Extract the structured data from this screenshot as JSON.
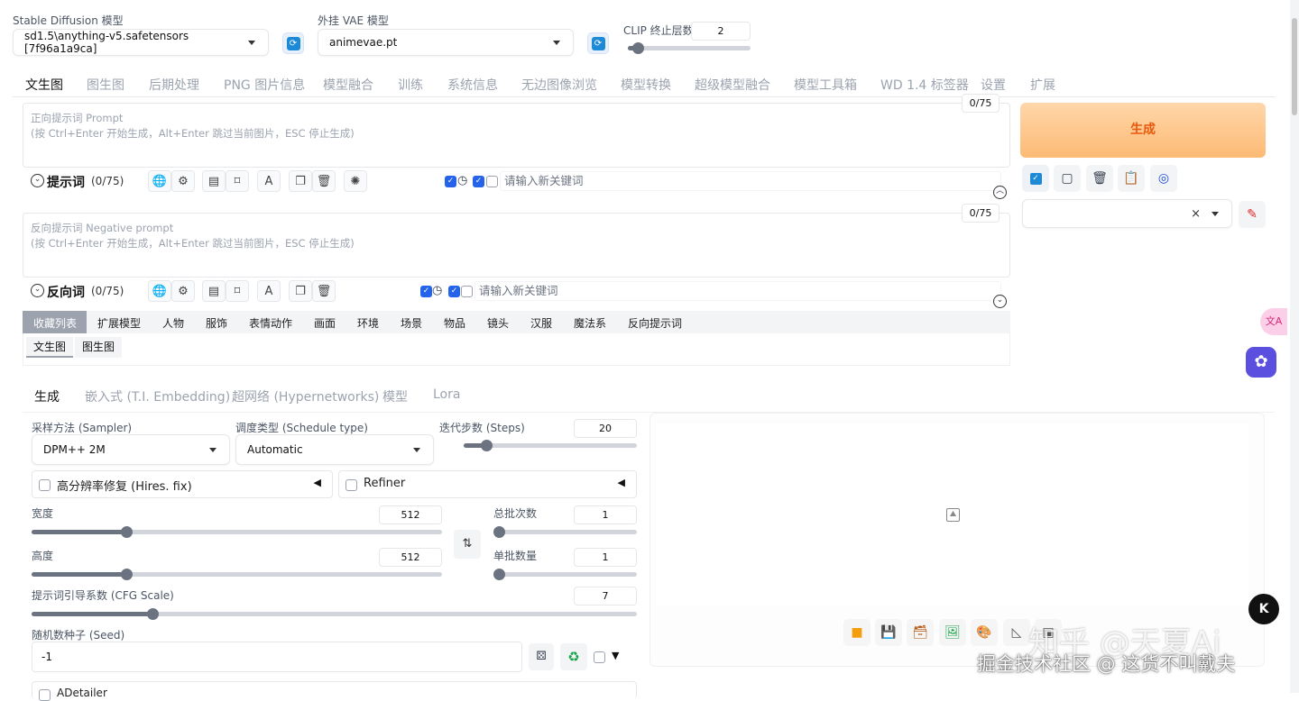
{
  "top": {
    "sd_model_label": "Stable Diffusion 模型",
    "sd_model_value": "sd1.5\\anything-v5.safetensors [7f96a1a9ca]",
    "vae_label": "外挂 VAE 模型",
    "vae_value": "animevae.pt",
    "clip_label": "CLIP 终止层数",
    "clip_value": "2"
  },
  "tabs": [
    "文生图",
    "图生图",
    "后期处理",
    "PNG 图片信息",
    "模型融合",
    "训练",
    "系统信息",
    "无边图像浏览",
    "模型转换",
    "超级模型融合",
    "模型工具箱",
    "WD 1.4 标签器",
    "设置",
    "扩展"
  ],
  "prompt": {
    "counter": "0/75",
    "placeholder_line1": "正向提示词 Prompt",
    "placeholder_line2": "(按 Ctrl+Enter 开始生成，Alt+Enter 跳过当前图片，ESC 停止生成)",
    "title": "提示词",
    "count": "(0/75)",
    "keyword_placeholder": "请输入新关键词"
  },
  "negative": {
    "counter": "0/75",
    "placeholder_line1": "反向提示词 Negative prompt",
    "placeholder_line2": "(按 Ctrl+Enter 开始生成，Alt+Enter 跳过当前图片，ESC 停止生成)",
    "title": "反向词",
    "count": "(0/75)",
    "keyword_placeholder": "请输入新关键词"
  },
  "generate_label": "生成",
  "categories": [
    "收藏列表",
    "扩展模型",
    "人物",
    "服饰",
    "表情动作",
    "画面",
    "环境",
    "场景",
    "物品",
    "镜头",
    "汉服",
    "魔法系",
    "反向提示词"
  ],
  "subcats": [
    "文生图",
    "图生图"
  ],
  "settings_tabs": [
    "生成",
    "嵌入式 (T.I. Embedding)",
    "超网络 (Hypernetworks)",
    "模型",
    "Lora"
  ],
  "settings": {
    "sampler_label": "采样方法 (Sampler)",
    "sampler_value": "DPM++ 2M",
    "schedule_label": "调度类型 (Schedule type)",
    "schedule_value": "Automatic",
    "steps_label": "迭代步数 (Steps)",
    "steps_value": "20",
    "hires_label": "高分辨率修复 (Hires. fix)",
    "refiner_label": "Refiner",
    "width_label": "宽度",
    "width_value": "512",
    "height_label": "高度",
    "height_value": "512",
    "batch_count_label": "总批次数",
    "batch_count_value": "1",
    "batch_size_label": "单批数量",
    "batch_size_value": "1",
    "cfg_label": "提示词引导系数 (CFG Scale)",
    "cfg_value": "7",
    "seed_label": "随机数种子 (Seed)",
    "seed_value": "-1",
    "adetailer_label": "ADetailer"
  },
  "sliders": {
    "clip": 0.08,
    "steps": 0.13,
    "width": 0.23,
    "height": 0.23,
    "batch_count": 0.0,
    "batch_size": 0.0,
    "cfg": 0.2
  },
  "watermark": {
    "line1": "知乎 @天夏Ai",
    "line2": "掘金技术社区 @ 这货不叫戴夫"
  },
  "colors": {
    "accent": "#2563eb",
    "generate_from": "#fed7aa",
    "generate_to": "#fdba74",
    "generate_text": "#ea580c"
  }
}
